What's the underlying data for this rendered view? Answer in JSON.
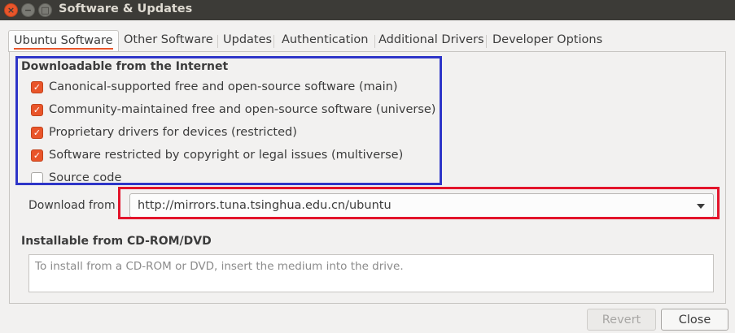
{
  "window": {
    "title": "Software & Updates",
    "close_glyph": "×",
    "min_glyph": "−",
    "max_glyph": "□"
  },
  "tabs": [
    {
      "label": "Ubuntu Software",
      "active": true
    },
    {
      "label": "Other Software",
      "active": false
    },
    {
      "label": "Updates",
      "active": false
    },
    {
      "label": "Authentication",
      "active": false
    },
    {
      "label": "Additional Drivers",
      "active": false
    },
    {
      "label": "Developer Options",
      "active": false
    }
  ],
  "downloadable": {
    "heading": "Downloadable from the Internet",
    "options": [
      {
        "label": "Canonical-supported free and open-source software (main)",
        "checked": true
      },
      {
        "label": "Community-maintained free and open-source software (universe)",
        "checked": true
      },
      {
        "label": "Proprietary drivers for devices (restricted)",
        "checked": true
      },
      {
        "label": "Software restricted by copyright or legal issues (multiverse)",
        "checked": true
      },
      {
        "label": "Source code",
        "checked": false
      }
    ]
  },
  "download_from": {
    "label": "Download from",
    "value": "http://mirrors.tuna.tsinghua.edu.cn/ubuntu"
  },
  "cdrom": {
    "heading": "Installable from CD-ROM/DVD",
    "placeholder": "To install from a CD-ROM or DVD, insert the medium into the drive."
  },
  "buttons": {
    "revert": "Revert",
    "close": "Close"
  },
  "colors": {
    "accent": "#e9552a",
    "highlight_blue": "#2e35c8",
    "highlight_red": "#e3142b",
    "titlebar": "#3c3b37"
  }
}
